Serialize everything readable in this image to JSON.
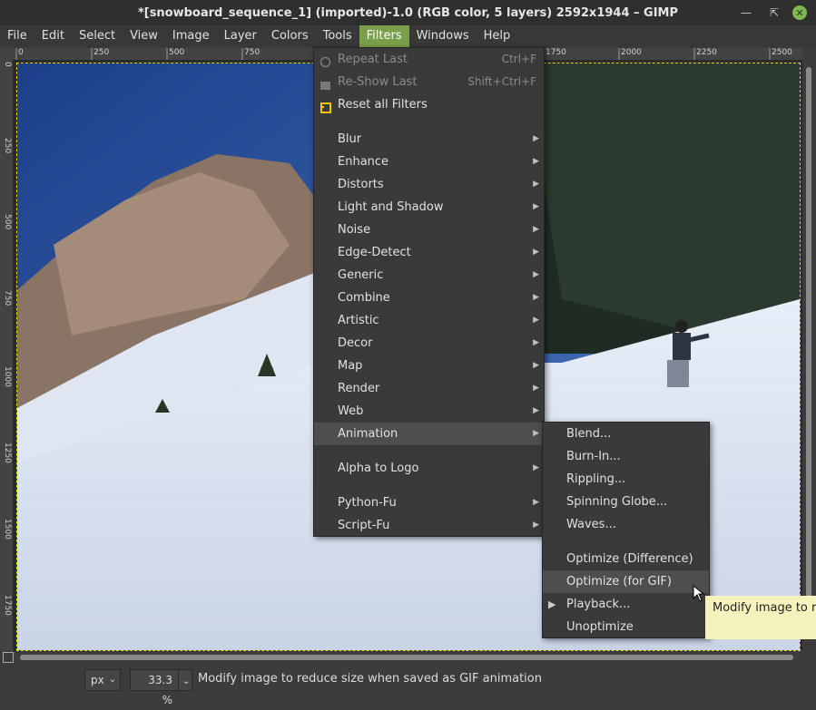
{
  "window": {
    "title": "*[snowboard_sequence_1] (imported)-1.0 (RGB color, 5 layers) 2592x1944 – GIMP"
  },
  "menubar": [
    "File",
    "Edit",
    "Select",
    "View",
    "Image",
    "Layer",
    "Colors",
    "Tools",
    "Filters",
    "Windows",
    "Help"
  ],
  "ruler_top": [
    "0",
    "250",
    "500",
    "750",
    "1750",
    "2000",
    "2250",
    "2500"
  ],
  "ruler_left": [
    "0",
    "250",
    "500",
    "750",
    "1000",
    "1250",
    "1500",
    "1750"
  ],
  "filters_menu": {
    "repeat_last": {
      "label": "Repeat Last",
      "shortcut": "Ctrl+F"
    },
    "reshow_last": {
      "label": "Re-Show Last",
      "shortcut": "Shift+Ctrl+F"
    },
    "reset_all": {
      "label": "Reset all Filters"
    },
    "items": [
      "Blur",
      "Enhance",
      "Distorts",
      "Light and Shadow",
      "Noise",
      "Edge-Detect",
      "Generic",
      "Combine",
      "Artistic",
      "Decor",
      "Map",
      "Render",
      "Web",
      "Animation"
    ],
    "alpha_to_logo": "Alpha to Logo",
    "python_fu": "Python-Fu",
    "script_fu": "Script-Fu"
  },
  "animation_menu": {
    "items": [
      "Blend...",
      "Burn-In...",
      "Rippling...",
      "Spinning Globe...",
      "Waves..."
    ],
    "items2": [
      "Optimize (Difference)",
      "Optimize (for GIF)",
      "Playback...",
      "Unoptimize"
    ]
  },
  "tooltip": "Modify image to reduce size when saved as GIF animation",
  "statusbar": {
    "unit": "px",
    "zoom": "33.3 %",
    "message": "Modify image to reduce size when saved as GIF animation"
  },
  "colors": {
    "accent": "#7a9f4a",
    "selection_border": "#e0d900",
    "tooltip_bg": "#f6f2bd"
  }
}
